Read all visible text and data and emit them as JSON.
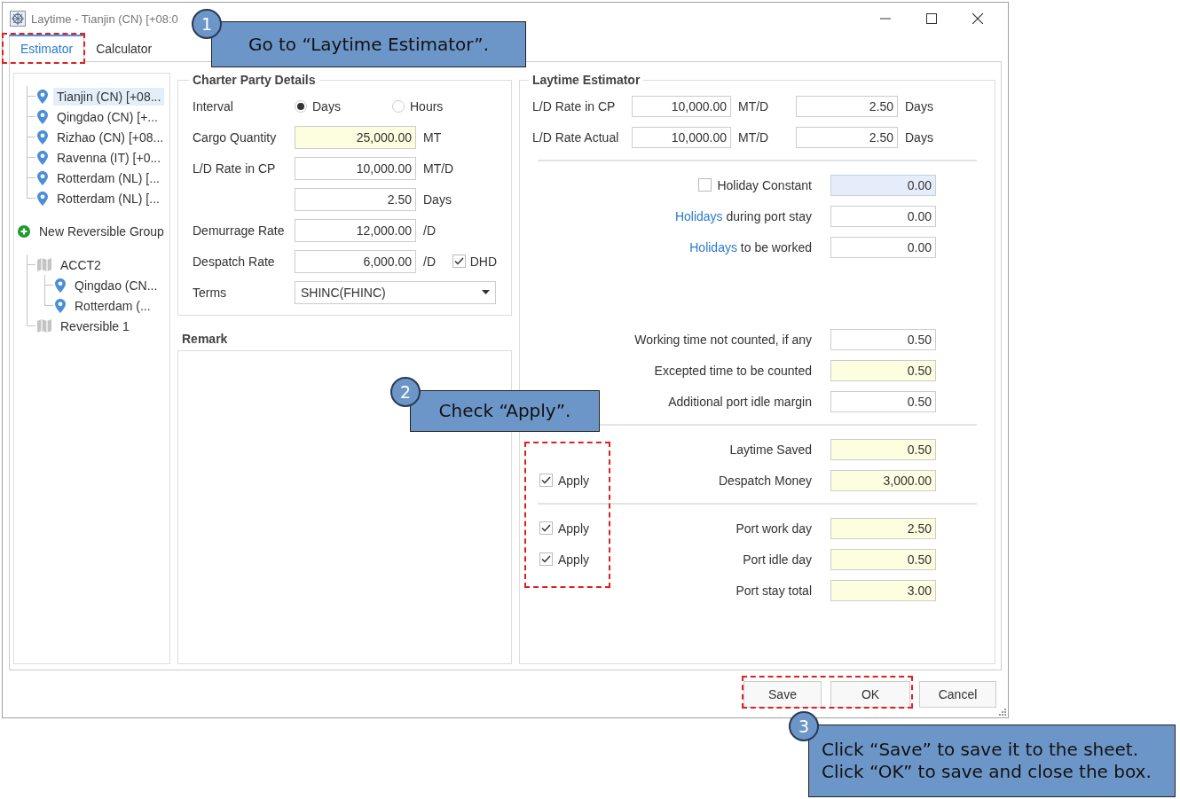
{
  "window": {
    "title": "Laytime - Tianjin (CN) [+08:0"
  },
  "tabs": [
    {
      "label": "Estimator",
      "selected": true
    },
    {
      "label": "Calculator",
      "selected": false
    }
  ],
  "ports": [
    {
      "label": "Tianjin (CN) [+08...",
      "kind": "port",
      "selected": true
    },
    {
      "label": "Qingdao (CN) [+...",
      "kind": "port",
      "selected": false
    },
    {
      "label": "Rizhao (CN) [+08...",
      "kind": "port",
      "selected": false
    },
    {
      "label": "Ravenna (IT) [+0...",
      "kind": "port",
      "selected": false
    },
    {
      "label": "Rotterdam (NL) [...",
      "kind": "port",
      "selected": false
    },
    {
      "label": "Rotterdam (NL) [...",
      "kind": "port",
      "selected": false
    }
  ],
  "new_group": {
    "label": "New Reversible Group"
  },
  "groups": [
    {
      "label": "ACCT2",
      "kind": "group",
      "selected": false,
      "children": [
        {
          "label": "Qingdao (CN...",
          "kind": "port",
          "selected": false
        },
        {
          "label": "Rotterdam (...",
          "kind": "port",
          "selected": false
        }
      ]
    },
    {
      "label": "Reversible 1",
      "kind": "group",
      "selected": false
    }
  ],
  "charter_party": {
    "title": "Charter Party Details",
    "rows": [
      {
        "kind": "radio",
        "label": "Interval",
        "options": [
          {
            "label": "Days",
            "selected": true
          },
          {
            "label": "Hours",
            "selected": false
          }
        ]
      },
      {
        "kind": "field",
        "label": "Cargo Quantity",
        "value": "25,000.00",
        "computed": true,
        "unit": "MT"
      },
      {
        "kind": "field",
        "label": "L/D Rate in CP",
        "value": "10,000.00",
        "computed": false,
        "unit": "MT/D"
      },
      {
        "kind": "field",
        "value": "2.50",
        "computed": false,
        "unit": "Days"
      },
      {
        "kind": "field",
        "label": "Demurrage Rate",
        "value": "12,000.00",
        "computed": false,
        "unit": "/D"
      },
      {
        "kind": "field",
        "label": "Despatch Rate",
        "value": "6,000.00",
        "computed": false,
        "unit": "/D",
        "check": {
          "label": "DHD",
          "checked": true
        }
      },
      {
        "kind": "select",
        "label": "Terms",
        "value": "SHINC(FHINC)"
      }
    ]
  },
  "remark": {
    "label": "Remark"
  },
  "estimator": {
    "title": "Laytime Estimator",
    "rates": [
      {
        "label": "L/D Rate in CP",
        "rate": "10,000.00",
        "rate_unit": "MT/D",
        "days": "2.50",
        "days_unit": "Days"
      },
      {
        "label": "L/D Rate Actual",
        "rate": "10,000.00",
        "rate_unit": "MT/D",
        "days": "2.50",
        "days_unit": "Days"
      }
    ],
    "sections": [
      {
        "divider": true,
        "rows": [
          {
            "kind": "check",
            "label": "Holiday Constant",
            "checked": false,
            "value": "0.00",
            "computed": false,
            "disabled": true
          },
          {
            "kind": "link",
            "link": "Holidays",
            "label": "during port stay",
            "value": "0.00",
            "computed": false,
            "disabled": false
          },
          {
            "kind": "link",
            "link": "Holidays",
            "label": "to be worked",
            "value": "0.00",
            "computed": false,
            "disabled": false
          }
        ]
      },
      {
        "divider": false,
        "rows": [
          {
            "kind": "plain",
            "label": "Working time not counted, if any",
            "value": "0.50",
            "computed": false,
            "disabled": false
          },
          {
            "kind": "plain",
            "label": "Excepted time to be counted",
            "value": "0.50",
            "computed": true,
            "disabled": false
          },
          {
            "kind": "plain",
            "label": "Additional port idle margin",
            "value": "0.50",
            "computed": false,
            "disabled": false
          }
        ]
      },
      {
        "divider": true,
        "rows": [
          {
            "kind": "plain",
            "label": "Laytime Saved",
            "value": "0.50",
            "computed": true,
            "disabled": false
          },
          {
            "kind": "plain",
            "label": "Despatch Money",
            "value": "3,000.00",
            "computed": true,
            "disabled": false,
            "apply": {
              "label": "Apply",
              "checked": true
            }
          }
        ]
      },
      {
        "divider": true,
        "rows": [
          {
            "kind": "plain",
            "label": "Port work day",
            "value": "2.50",
            "computed": true,
            "disabled": false,
            "apply": {
              "label": "Apply",
              "checked": true
            }
          },
          {
            "kind": "plain",
            "label": "Port idle day",
            "value": "0.50",
            "computed": true,
            "disabled": false,
            "apply": {
              "label": "Apply",
              "checked": true
            }
          },
          {
            "kind": "plain",
            "label": "Port stay total",
            "value": "3.00",
            "computed": true,
            "disabled": false
          }
        ]
      }
    ]
  },
  "buttons": [
    {
      "label": "Save"
    },
    {
      "label": "OK"
    },
    {
      "label": "Cancel"
    }
  ],
  "callouts": [
    {
      "number": "1",
      "lines": [
        "Go to “Laytime Estimator”."
      ]
    },
    {
      "number": "2",
      "lines": [
        "Check “Apply”."
      ]
    },
    {
      "number": "3",
      "lines": [
        "Click “Save” to save it to the sheet.",
        "Click “OK” to save and close the box."
      ]
    }
  ]
}
